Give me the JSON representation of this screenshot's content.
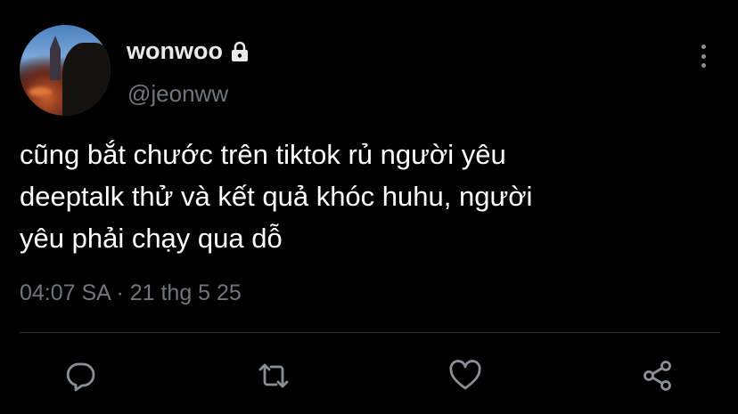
{
  "profile": {
    "display_name": "wonwoo",
    "handle": "@jeonww",
    "protected": true
  },
  "tweet": {
    "text_lines": [
      "cũng bắt chước trên tiktok rủ người yêu",
      "deeptalk thử và kết quả khóc huhu, người",
      "yêu phải chạy qua dỗ"
    ],
    "time": "04:07 SA",
    "separator": "·",
    "date": "21 thg 5 25"
  },
  "actions": {
    "icons": [
      "reply-icon",
      "retweet-icon",
      "like-icon",
      "share-icon"
    ]
  },
  "colors": {
    "background": "#000000",
    "text": "#ffffff",
    "secondary": "#71767b",
    "divider": "#2f3336"
  }
}
